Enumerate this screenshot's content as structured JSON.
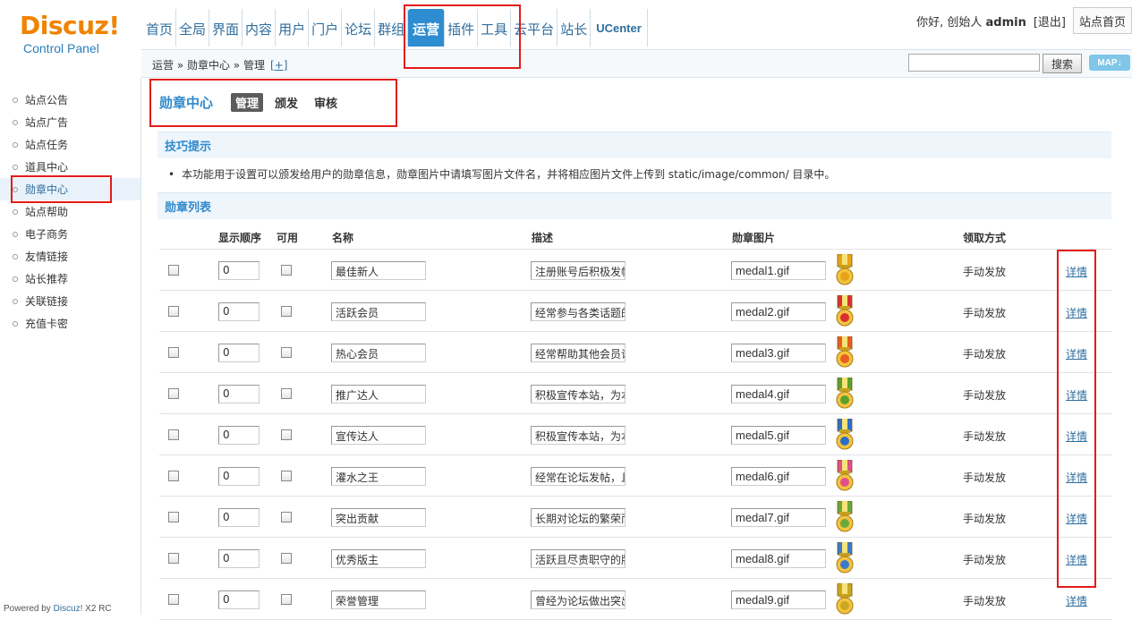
{
  "logo": {
    "brand": "Discuz!",
    "sub": "Control Panel"
  },
  "topnav": {
    "tabs": [
      "首页",
      "全局",
      "界面",
      "内容",
      "用户",
      "门户",
      "论坛",
      "群组",
      "运营",
      "插件",
      "工具",
      "云平台",
      "站长",
      "UCenter"
    ],
    "active": "运营"
  },
  "userbar": {
    "greet_prefix": "你好, 创始人 ",
    "username": "admin",
    "logout": "[退出]",
    "site_home": "站点首页"
  },
  "breadcrumb": {
    "text": "运营 » 勋章中心 » 管理",
    "plus": "[+]"
  },
  "search": {
    "value": "",
    "button": "搜索",
    "map": "MAP"
  },
  "sidebar": {
    "items": [
      "站点公告",
      "站点广告",
      "站点任务",
      "道具中心",
      "勋章中心",
      "站点帮助",
      "电子商务",
      "友情链接",
      "站长推荐",
      "关联链接",
      "充值卡密"
    ],
    "active": "勋章中心",
    "powered_prefix": "Powered by ",
    "powered_brand": "Discuz!",
    "powered_version": " X2 RC"
  },
  "pagehead": {
    "title": "勋章中心",
    "tabs": [
      "管理",
      "颁发",
      "审核"
    ],
    "active": "管理"
  },
  "tips": {
    "title": "技巧提示",
    "text": "本功能用于设置可以颁发给用户的勋章信息，勋章图片中请填写图片文件名，并将相应图片文件上传到 static/image/common/ 目录中。"
  },
  "list": {
    "title": "勋章列表",
    "headers": {
      "order": "显示顺序",
      "enabled": "可用",
      "name": "名称",
      "desc": "描述",
      "image": "勋章图片",
      "method": "领取方式"
    },
    "rows": [
      {
        "order": "0",
        "name": "最佳新人",
        "desc": "注册账号后积极发帖",
        "image": "medal1.gif",
        "method": "手动发放",
        "detail": "详情",
        "color": "#e8a317"
      },
      {
        "order": "0",
        "name": "活跃会员",
        "desc": "经常参与各类话题的",
        "image": "medal2.gif",
        "method": "手动发放",
        "detail": "详情",
        "color": "#d93030"
      },
      {
        "order": "0",
        "name": "热心会员",
        "desc": "经常帮助其他会员论",
        "image": "medal3.gif",
        "method": "手动发放",
        "detail": "详情",
        "color": "#e85d20"
      },
      {
        "order": "0",
        "name": "推广达人",
        "desc": "积极宣传本站，为本",
        "image": "medal4.gif",
        "method": "手动发放",
        "detail": "详情",
        "color": "#5aa02c"
      },
      {
        "order": "0",
        "name": "宣传达人",
        "desc": "积极宣传本站，为本",
        "image": "medal5.gif",
        "method": "手动发放",
        "detail": "详情",
        "color": "#2f6ec8"
      },
      {
        "order": "0",
        "name": "灌水之王",
        "desc": "经常在论坛发帖，且",
        "image": "medal6.gif",
        "method": "手动发放",
        "detail": "详情",
        "color": "#e0508a"
      },
      {
        "order": "0",
        "name": "突出贡献",
        "desc": "长期对论坛的繁荣而",
        "image": "medal7.gif",
        "method": "手动发放",
        "detail": "详情",
        "color": "#6aa83a"
      },
      {
        "order": "0",
        "name": "优秀版主",
        "desc": "活跃且尽责职守的版",
        "image": "medal8.gif",
        "method": "手动发放",
        "detail": "详情",
        "color": "#3a7ac8"
      },
      {
        "order": "0",
        "name": "荣誉管理",
        "desc": "曾经为论坛做出突出",
        "image": "medal9.gif",
        "method": "手动发放",
        "detail": "详情",
        "color": "#c8a820"
      }
    ]
  }
}
